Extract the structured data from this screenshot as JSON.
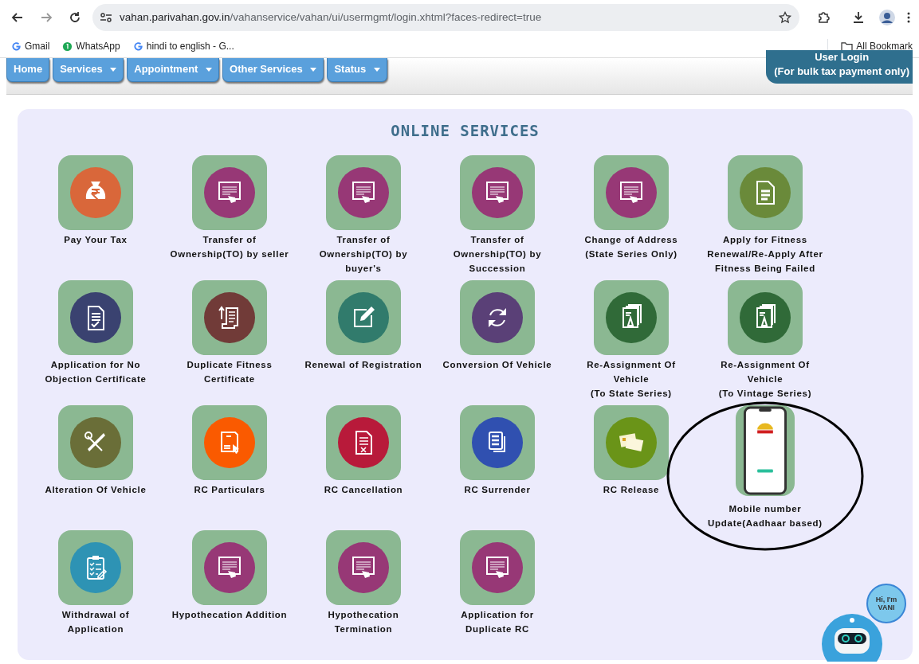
{
  "browser": {
    "url_host": "vahan.parivahan.gov.in",
    "url_path": "/vahanservice/vahan/ui/usermgmt/login.xhtml?faces-redirect=true",
    "bookmarks": [
      {
        "label": "Gmail",
        "kind": "google"
      },
      {
        "label": "WhatsApp",
        "kind": "whatsapp"
      },
      {
        "label": "hindi to english - G...",
        "kind": "google"
      }
    ],
    "all_bookmarks": "All Bookmark"
  },
  "menu": [
    {
      "label": "Home",
      "dropdown": false
    },
    {
      "label": "Services",
      "dropdown": true
    },
    {
      "label": "Appointment",
      "dropdown": true
    },
    {
      "label": "Other Services",
      "dropdown": true
    },
    {
      "label": "Status",
      "dropdown": true
    }
  ],
  "login": {
    "line1": "User Login",
    "line2": "(For bulk tax payment only)"
  },
  "section_title": "ONLINE SERVICES",
  "services": [
    {
      "label": "Pay Your Tax",
      "kind": "money-bag",
      "color": "#d9673a",
      "highlighted": false
    },
    {
      "label": "Transfer of Ownership(TO) by seller",
      "kind": "web-form",
      "color": "#973876",
      "highlighted": false
    },
    {
      "label": "Transfer of Ownership(TO) by buyer's",
      "kind": "web-form",
      "color": "#973876",
      "highlighted": false
    },
    {
      "label": "Transfer of Ownership(TO) by Succession",
      "kind": "web-form",
      "color": "#973876",
      "highlighted": false
    },
    {
      "label": "Change of Address (State Series Only)",
      "kind": "web-form",
      "color": "#973876",
      "highlighted": false
    },
    {
      "label": "Apply for Fitness Renewal/Re-Apply After Fitness Being Failed",
      "kind": "document",
      "color": "#6a8a3a",
      "highlighted": false
    },
    {
      "label": "Application for No Objection Certificate",
      "kind": "doc-check",
      "color": "#3a4270",
      "highlighted": false
    },
    {
      "label": "Duplicate Fitness Certificate",
      "kind": "scroll",
      "color": "#713b38",
      "highlighted": false
    },
    {
      "label": "Renewal of Registration",
      "kind": "edit",
      "color": "#317b6c",
      "highlighted": false
    },
    {
      "label": "Conversion Of Vehicle",
      "kind": "refresh",
      "color": "#5a4077",
      "highlighted": false
    },
    {
      "label": "Re-Assignment Of Vehicle\n(To State Series)",
      "kind": "certificate",
      "color": "#306a38",
      "highlighted": false
    },
    {
      "label": "Re-Assignment Of Vehicle\n(To Vintage Series)",
      "kind": "certificate",
      "color": "#306a38",
      "highlighted": false
    },
    {
      "label": "Alteration Of Vehicle",
      "kind": "tools",
      "color": "#6a6e38",
      "highlighted": false
    },
    {
      "label": "RC Particulars",
      "kind": "rc-card",
      "color": "#fa5a00",
      "highlighted": false
    },
    {
      "label": "RC Cancellation",
      "kind": "doc-x",
      "color": "#b81a3a",
      "highlighted": false
    },
    {
      "label": "RC Surrender",
      "kind": "copy",
      "color": "#3050b0",
      "highlighted": false
    },
    {
      "label": "RC Release",
      "kind": "id-cards",
      "color": "#6a9418",
      "highlighted": false
    },
    {
      "label": "Mobile number Update(Aadhaar based)",
      "kind": "phone",
      "color": "#ffffff",
      "highlighted": true
    },
    {
      "label": "Withdrawal of Application",
      "kind": "clipboard",
      "color": "#2e93b4",
      "highlighted": false
    },
    {
      "label": "Hypothecation Addition",
      "kind": "web-form",
      "color": "#973876",
      "highlighted": false
    },
    {
      "label": "Hypothecation Termination",
      "kind": "web-form",
      "color": "#973876",
      "highlighted": false
    },
    {
      "label": "Application for Duplicate RC",
      "kind": "web-form",
      "color": "#973876",
      "highlighted": false
    }
  ],
  "assistant": {
    "bubble": "Hi, I'm VANI"
  }
}
